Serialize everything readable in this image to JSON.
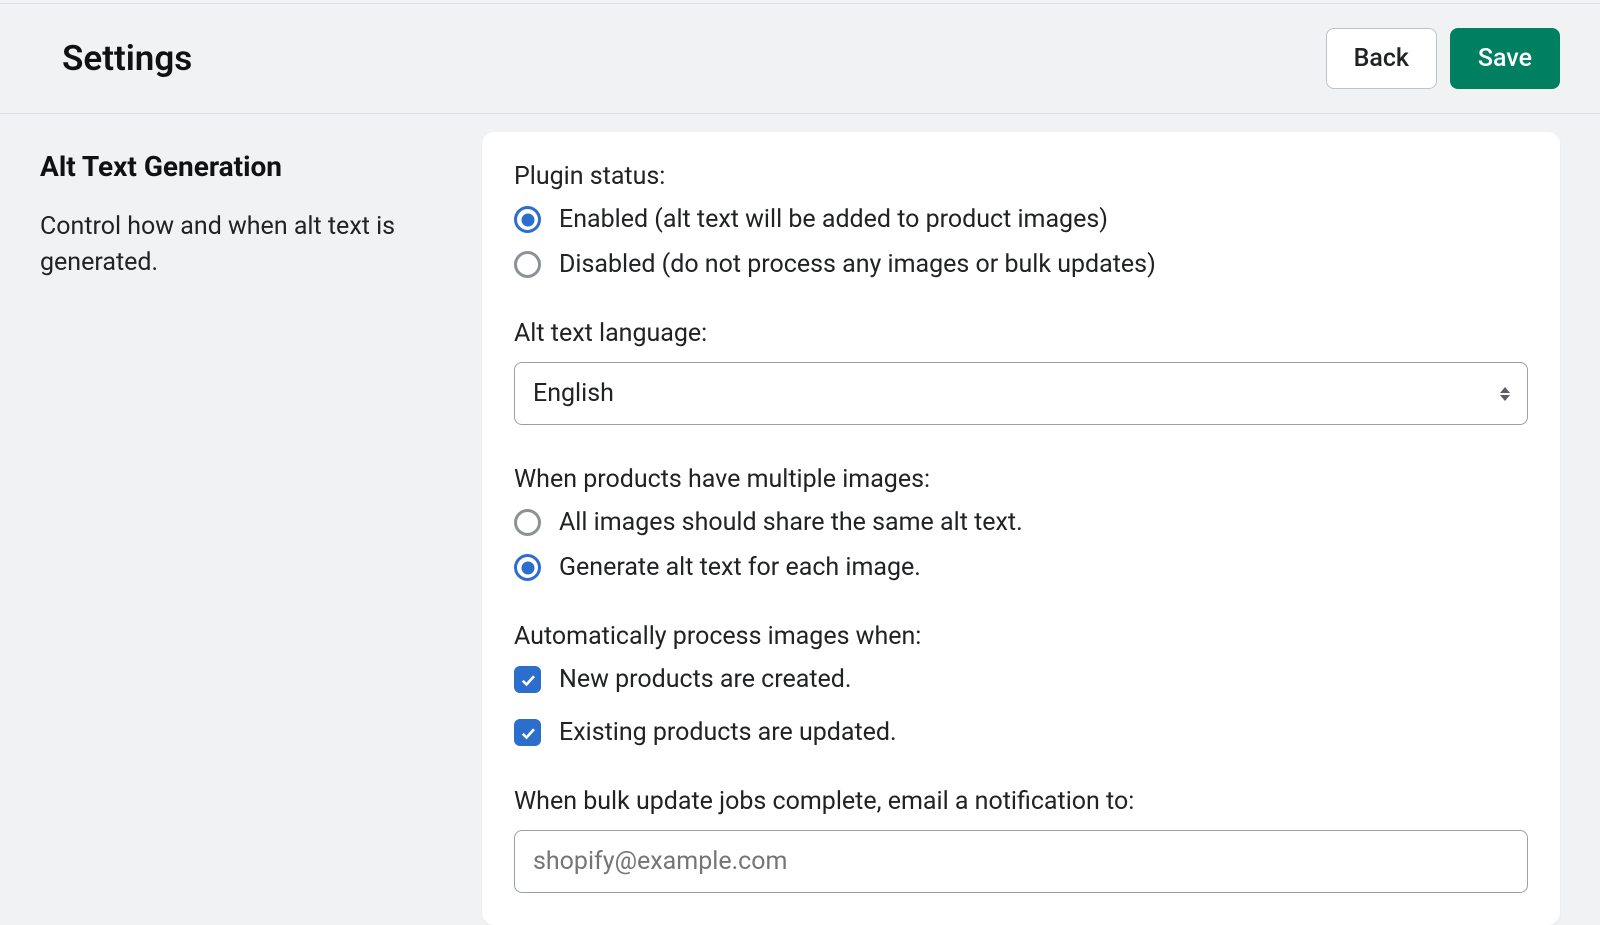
{
  "header": {
    "title": "Settings",
    "back_label": "Back",
    "save_label": "Save"
  },
  "section": {
    "title": "Alt Text Generation",
    "description": "Control how and when alt text is generated."
  },
  "form": {
    "plugin_status": {
      "label": "Plugin status:",
      "options": {
        "enabled": "Enabled (alt text will be added to product images)",
        "disabled": "Disabled (do not process any images or bulk updates)"
      },
      "selected": "enabled"
    },
    "language": {
      "label": "Alt text language:",
      "selected": "English"
    },
    "multiple_images": {
      "label": "When products have multiple images:",
      "options": {
        "share": "All images should share the same alt text.",
        "each": "Generate alt text for each image."
      },
      "selected": "each"
    },
    "auto_process": {
      "label": "Automatically process images when:",
      "options": {
        "new": "New products are created.",
        "updated": "Existing products are updated."
      },
      "new_checked": true,
      "updated_checked": true
    },
    "notification": {
      "label": "When bulk update jobs complete, email a notification to:",
      "placeholder": "shopify@example.com"
    }
  }
}
